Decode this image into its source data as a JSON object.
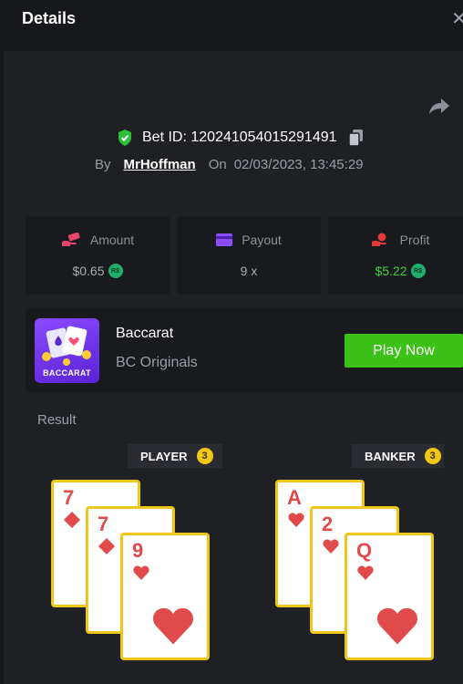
{
  "header": {
    "title": "Details",
    "close_icon": "close-icon"
  },
  "bet": {
    "id_text": "Bet ID: 120241054015291491",
    "by_label": "By",
    "username": "MrHoffman",
    "on_label": "On",
    "datetime": "02/03/2023, 13:45:29"
  },
  "stats": {
    "amount": {
      "label": "Amount",
      "value": "$0.65",
      "icon": "money-hand-icon"
    },
    "payout": {
      "label": "Payout",
      "value": "9 x",
      "icon": "card-icon"
    },
    "profit": {
      "label": "Profit",
      "value": "$5.22",
      "icon": "profit-hand-icon"
    },
    "coin_label": "R$"
  },
  "game": {
    "name": "Baccarat",
    "provider": "BC Originals",
    "thumb_label": "BACCARAT",
    "play_label": "Play Now"
  },
  "result": {
    "label": "Result",
    "player": {
      "label": "PLAYER",
      "count": "3",
      "cards": [
        {
          "rank": "7",
          "suit": "diamond"
        },
        {
          "rank": "7",
          "suit": "diamond"
        },
        {
          "rank": "9",
          "suit": "heart"
        }
      ]
    },
    "banker": {
      "label": "BANKER",
      "count": "3",
      "cards": [
        {
          "rank": "A",
          "suit": "heart"
        },
        {
          "rank": "2",
          "suit": "heart"
        },
        {
          "rank": "Q",
          "suit": "heart"
        }
      ]
    }
  },
  "colors": {
    "accent_green": "#3bc117",
    "card_red": "#e04a4a",
    "card_border": "#f0c419"
  }
}
